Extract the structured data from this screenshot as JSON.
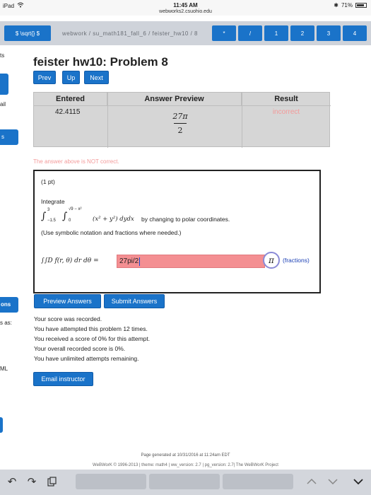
{
  "status": {
    "device": "iPad",
    "time": "11:45 AM",
    "url": "webworks2.csuohio.edu",
    "battery": "71%"
  },
  "keybar": {
    "first_key": "$ \\sqrt{} $",
    "faded_text": "webwork / su_math181_fall_6 / feister_hw10 / 8",
    "keys": [
      "*",
      "/",
      "1",
      "2",
      "3",
      "4"
    ]
  },
  "sidebar": {
    "labels": [
      "ts",
      "ail",
      "s",
      "ons",
      "s as:",
      "ML"
    ]
  },
  "page": {
    "title": "feister hw10: Problem 8",
    "nav": {
      "prev": "Prev",
      "up": "Up",
      "next": "Next"
    }
  },
  "results": {
    "headers": [
      "Entered",
      "Answer Preview",
      "Result"
    ],
    "entered": "42.4115",
    "preview_numerator": "27π",
    "preview_denominator": "2",
    "result": "incorrect"
  },
  "feedback": "The answer above is NOT correct.",
  "problem": {
    "points": "(1 pt)",
    "instruction": "Integrate",
    "integral_lower_outer": "−1.5",
    "integral_upper_outer": "3",
    "integral_lower_inner": "0",
    "integral_upper_inner": "√9 − x²",
    "integrand": "(x² + y²) dydx",
    "method": "by changing to polar coordinates.",
    "hint": "(Use symbolic notation and fractions where needed.)",
    "answer_label": "∫∫D f(r, θ) dr dθ =",
    "answer_value": "27pi/2",
    "pi_symbol": "π",
    "fractions_link": "(fractions)"
  },
  "actions": {
    "preview": "Preview Answers",
    "submit": "Submit Answers"
  },
  "score": [
    "Your score was recorded.",
    "You have attempted this problem 12 times.",
    "You received a score of 0% for this attempt.",
    "Your overall recorded score is 0%.",
    "You have unlimited attempts remaining."
  ],
  "email_button": "Email instructor",
  "footer": {
    "generated": "Page generated at 10/31/2016 at 11:24am EDT",
    "credits": "WeBWorK © 1996-2013 | theme: math4 | ww_version: 2.7 | pg_version: 2.7| The WeBWorK Project"
  },
  "colors": {
    "accent": "#1a73c9",
    "incorrect_text": "#f39a9a",
    "answer_bg": "#f48f92"
  }
}
